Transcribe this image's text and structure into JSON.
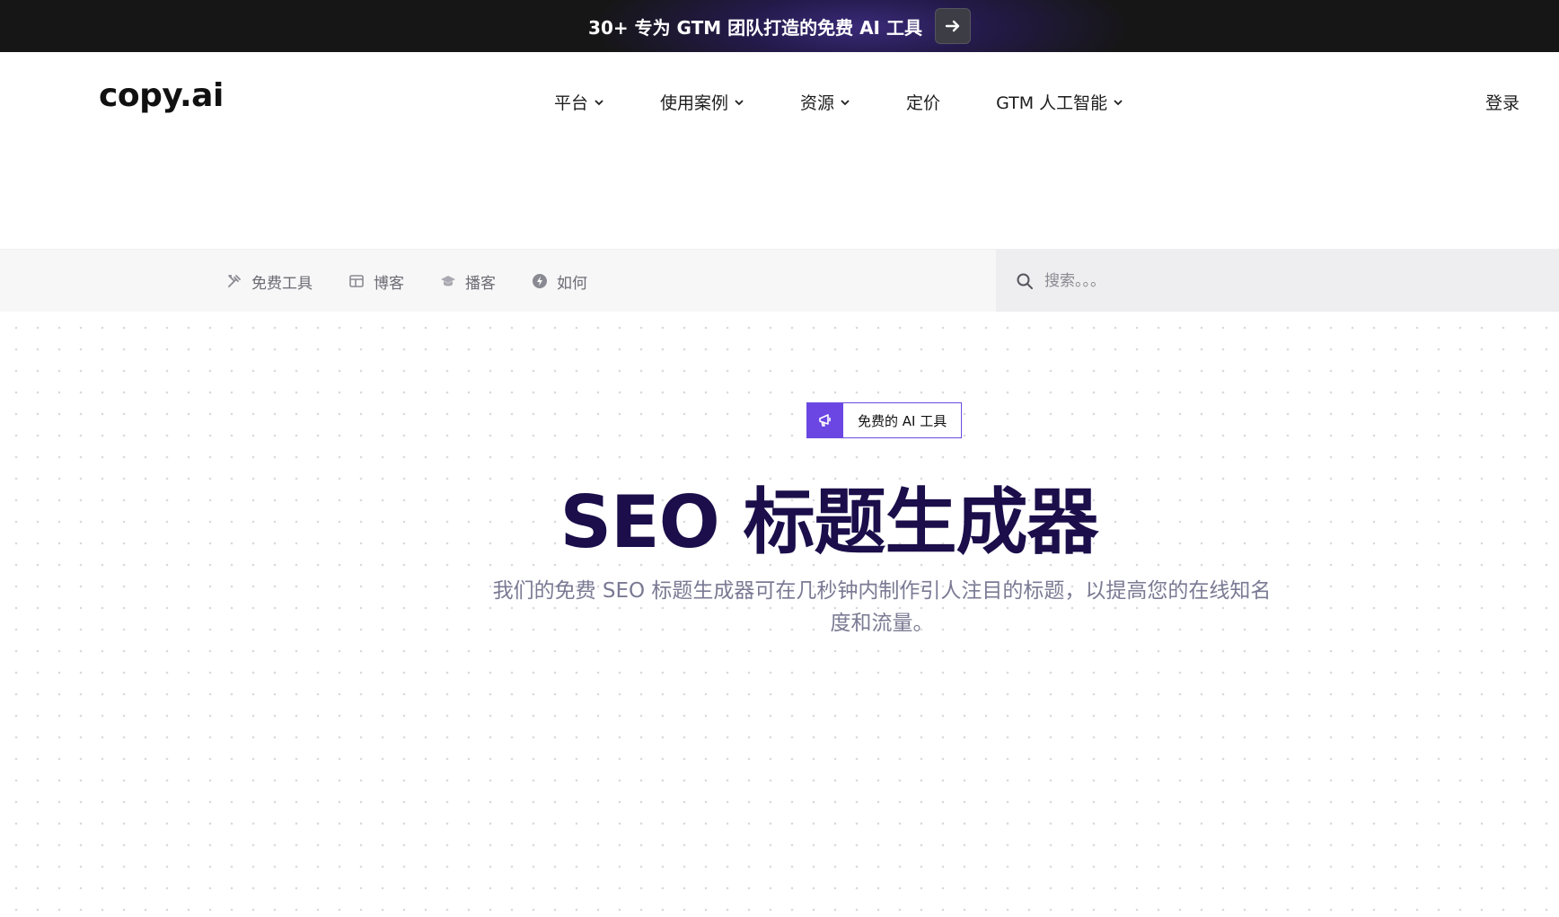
{
  "announcement": {
    "text": "30+ 专为 GTM 团队打造的免费 AI 工具",
    "arrow_icon": "arrow-right-icon"
  },
  "nav": {
    "logo": "copy.ai",
    "items": [
      {
        "label": "平台",
        "has_dropdown": true
      },
      {
        "label": "使用案例",
        "has_dropdown": true
      },
      {
        "label": "资源",
        "has_dropdown": true
      },
      {
        "label": "定价",
        "has_dropdown": false
      },
      {
        "label": "GTM 人工智能",
        "has_dropdown": true
      }
    ],
    "login": "登录"
  },
  "subnav": {
    "links": [
      {
        "label": "免费工具",
        "icon": "tools-icon"
      },
      {
        "label": "博客",
        "icon": "blog-icon"
      },
      {
        "label": "播客",
        "icon": "graduation-cap-icon"
      },
      {
        "label": "如何",
        "icon": "lightning-circle-icon"
      }
    ],
    "search": {
      "placeholder": "搜索。。。",
      "value": ""
    }
  },
  "hero": {
    "badge": "免费的 AI 工具",
    "title": "SEO 标题生成器",
    "subtitle": "我们的免费 SEO 标题生成器可在几秒钟内制作引人注目的标题，以提高您的在线知名度和流量。"
  },
  "colors": {
    "announcement_bg": "#161616",
    "accent": "#6b46e3",
    "hero_title": "#1b0e4a",
    "hero_subtitle": "#7a7a94"
  }
}
